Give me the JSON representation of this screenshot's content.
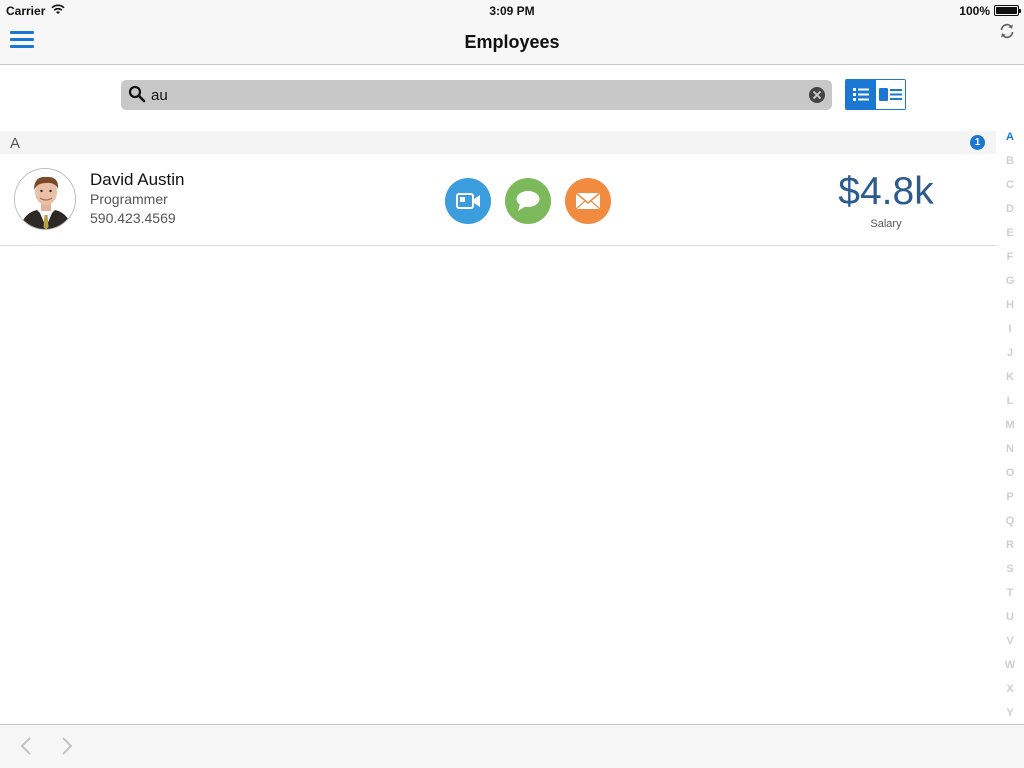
{
  "status_bar": {
    "carrier": "Carrier",
    "time": "3:09 PM",
    "battery": "100%"
  },
  "nav": {
    "title": "Employees",
    "menu_icon": "hamburger-icon",
    "refresh_icon": "refresh-icon"
  },
  "search": {
    "value": "au",
    "placeholder": ""
  },
  "view_toggle": {
    "selected": "list",
    "options": [
      "list",
      "card"
    ]
  },
  "section": {
    "letter": "A",
    "count": "1"
  },
  "employees": [
    {
      "name": "David Austin",
      "title": "Programmer",
      "phone": "590.423.4569",
      "salary": "$4.8k",
      "salary_label": "Salary",
      "actions": [
        "video-call-icon",
        "chat-icon",
        "email-icon"
      ]
    }
  ],
  "index": [
    "A",
    "B",
    "C",
    "D",
    "E",
    "F",
    "G",
    "H",
    "I",
    "J",
    "K",
    "L",
    "M",
    "N",
    "O",
    "P",
    "Q",
    "R",
    "S",
    "T",
    "U",
    "V",
    "W",
    "X",
    "Y"
  ],
  "index_active": "A",
  "colors": {
    "accent": "#1a78d2",
    "salary": "#2e5b8e",
    "video": "#3b9ddd",
    "chat": "#7cb95b",
    "email": "#f08b3f"
  }
}
